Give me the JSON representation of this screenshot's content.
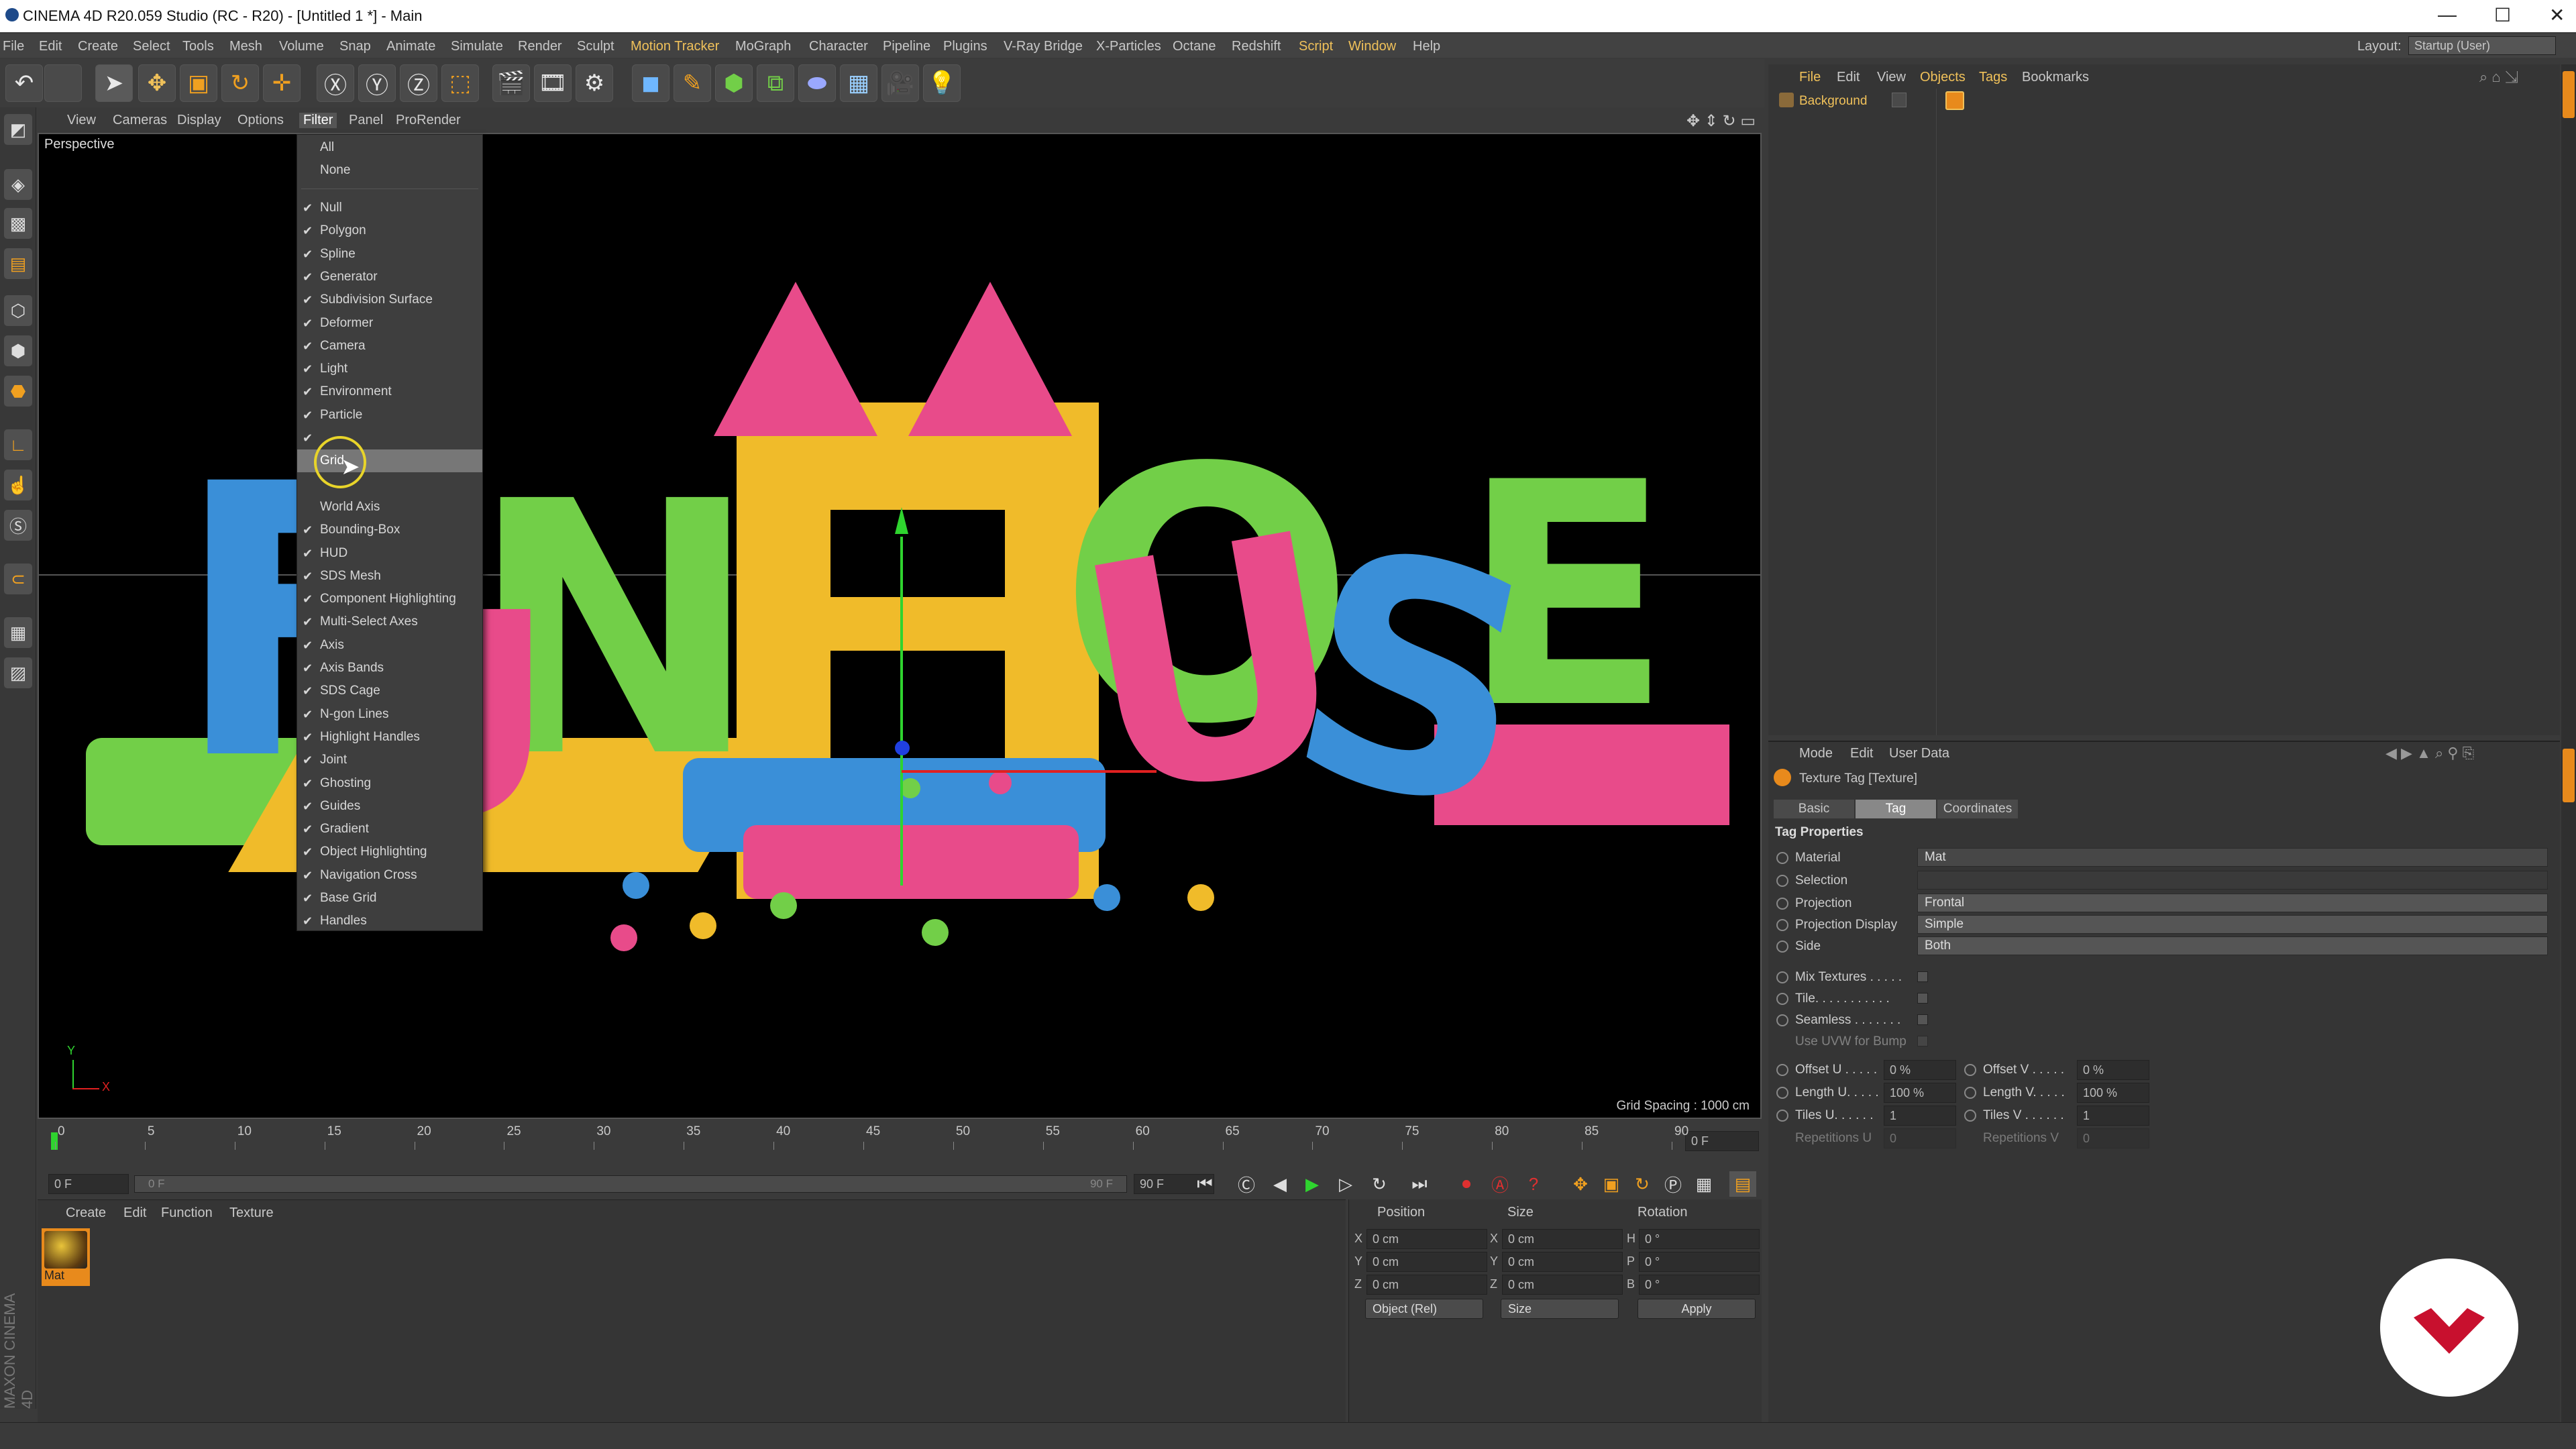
{
  "window": {
    "title": "CINEMA 4D R20.059 Studio (RC - R20) - [Untitled 1 *] - Main",
    "controls": [
      "—",
      "☐",
      "✕"
    ]
  },
  "menubar": {
    "items": [
      "File",
      "Edit",
      "Create",
      "Select",
      "Tools",
      "Mesh",
      "Volume",
      "Snap",
      "Animate",
      "Simulate",
      "Render",
      "Sculpt",
      "Motion Tracker",
      "MoGraph",
      "Character",
      "Pipeline",
      "Plugins",
      "V-Ray Bridge",
      "X-Particles",
      "Octane",
      "Redshift",
      "Script",
      "Window",
      "Help"
    ],
    "layout_label": "Layout:",
    "layout_value": "Startup (User)"
  },
  "viewport_menu": {
    "items": [
      "View",
      "Cameras",
      "Display",
      "Options",
      "Filter",
      "Panel",
      "ProRender"
    ],
    "active": "Filter"
  },
  "viewport": {
    "label": "Perspective",
    "grid_spacing": "Grid Spacing : 1000 cm",
    "axis_y": "Y",
    "axis_x": "X",
    "scene_letters": [
      "F",
      "U",
      "N",
      "H",
      "O",
      "U",
      "S",
      "E"
    ],
    "colors": {
      "blue": "#3a8fd8",
      "green": "#72cf48",
      "yellow": "#f0bb2a",
      "pink": "#e84b8a"
    }
  },
  "filter_menu": {
    "top_items": [
      {
        "label": "All"
      },
      {
        "label": "None"
      }
    ],
    "items": [
      {
        "label": "Null",
        "checked": true
      },
      {
        "label": "Polygon",
        "checked": true
      },
      {
        "label": "Spline",
        "checked": true
      },
      {
        "label": "Generator",
        "checked": true
      },
      {
        "label": "Subdivision Surface",
        "checked": true
      },
      {
        "label": "Deformer",
        "checked": true
      },
      {
        "label": "Camera",
        "checked": true
      },
      {
        "label": "Light",
        "checked": true
      },
      {
        "label": "Environment",
        "checked": true
      },
      {
        "label": "Particle",
        "checked": true
      },
      {
        "label": "",
        "checked": true
      },
      {
        "label": "Grid",
        "checked": false,
        "highlighted": true
      },
      {
        "label": "",
        "checked": false
      },
      {
        "label": "World Axis",
        "checked": false
      },
      {
        "label": "Bounding-Box",
        "checked": true
      },
      {
        "label": "HUD",
        "checked": true
      },
      {
        "label": "SDS Mesh",
        "checked": true
      },
      {
        "label": "Component Highlighting",
        "checked": true
      },
      {
        "label": "Multi-Select Axes",
        "checked": true
      },
      {
        "label": "Axis",
        "checked": true
      },
      {
        "label": "Axis Bands",
        "checked": true
      },
      {
        "label": "SDS Cage",
        "checked": true
      },
      {
        "label": "N-gon Lines",
        "checked": true
      },
      {
        "label": "Highlight Handles",
        "checked": true
      },
      {
        "label": "Joint",
        "checked": true
      },
      {
        "label": "Ghosting",
        "checked": true
      },
      {
        "label": "Guides",
        "checked": true
      },
      {
        "label": "Gradient",
        "checked": true
      },
      {
        "label": "Object Highlighting",
        "checked": true
      },
      {
        "label": "Navigation Cross",
        "checked": true
      },
      {
        "label": "Base Grid",
        "checked": true
      },
      {
        "label": "Handles",
        "checked": true
      }
    ]
  },
  "timeline": {
    "ticks": [
      "0",
      "5",
      "10",
      "15",
      "20",
      "25",
      "30",
      "35",
      "40",
      "45",
      "50",
      "55",
      "60",
      "65",
      "70",
      "75",
      "80",
      "85",
      "90"
    ],
    "current_frame_right": "0 F",
    "start_field": "0 F",
    "range_start": "0 F",
    "range_end": "90 F",
    "end_field": "90 F"
  },
  "material_panel": {
    "menu": [
      "Create",
      "Edit",
      "Function",
      "Texture"
    ],
    "material_name": "Mat"
  },
  "coords_panel": {
    "headers": [
      "Position",
      "Size",
      "Rotation"
    ],
    "rows": [
      {
        "axis": "X",
        "pos": "0 cm",
        "size_axis": "X",
        "size": "0 cm",
        "rot_axis": "H",
        "rot": "0 °"
      },
      {
        "axis": "Y",
        "pos": "0 cm",
        "size_axis": "Y",
        "size": "0 cm",
        "rot_axis": "P",
        "rot": "0 °"
      },
      {
        "axis": "Z",
        "pos": "0 cm",
        "size_axis": "Z",
        "size": "0 cm",
        "rot_axis": "B",
        "rot": "0 °"
      }
    ],
    "mode": "Object (Rel)",
    "size_mode": "Size",
    "apply": "Apply"
  },
  "object_manager": {
    "menu": [
      "File",
      "Edit",
      "View",
      "Objects",
      "Tags",
      "Bookmarks"
    ],
    "highlight": "Objects",
    "object_name": "Background"
  },
  "attribute_manager": {
    "menu": [
      "Mode",
      "Edit",
      "User Data"
    ],
    "title": "Texture Tag [Texture]",
    "tabs": [
      "Basic",
      "Tag",
      "Coordinates"
    ],
    "active_tab": "Tag",
    "section": "Tag Properties",
    "rows": [
      {
        "label": "Material",
        "value": "Mat"
      },
      {
        "label": "Selection",
        "value": ""
      },
      {
        "label": "Projection",
        "value": "Frontal"
      },
      {
        "label": "Projection Display",
        "value": "Simple"
      },
      {
        "label": "Side",
        "value": "Both"
      }
    ],
    "checks": [
      {
        "label": "Mix Textures . . . . ."
      },
      {
        "label": "Tile. . . . . . . . . . ."
      },
      {
        "label": "Seamless . . . . . . ."
      },
      {
        "label": "Use UVW for Bump"
      }
    ],
    "pairs": [
      {
        "l1": "Offset U . . . . .",
        "v1": "0 %",
        "l2": "Offset V . . . . .",
        "v2": "0 %"
      },
      {
        "l1": "Length U. . . . .",
        "v1": "100 %",
        "l2": "Length V. . . . .",
        "v2": "100 %"
      },
      {
        "l1": "Tiles U. . . . . .",
        "v1": "1",
        "l2": "Tiles V . . . . . .",
        "v2": "1"
      },
      {
        "l1": "Repetitions U",
        "v1": "0",
        "l2": "Repetitions V",
        "v2": "0"
      }
    ]
  },
  "side_label": "MAXON CINEMA 4D"
}
